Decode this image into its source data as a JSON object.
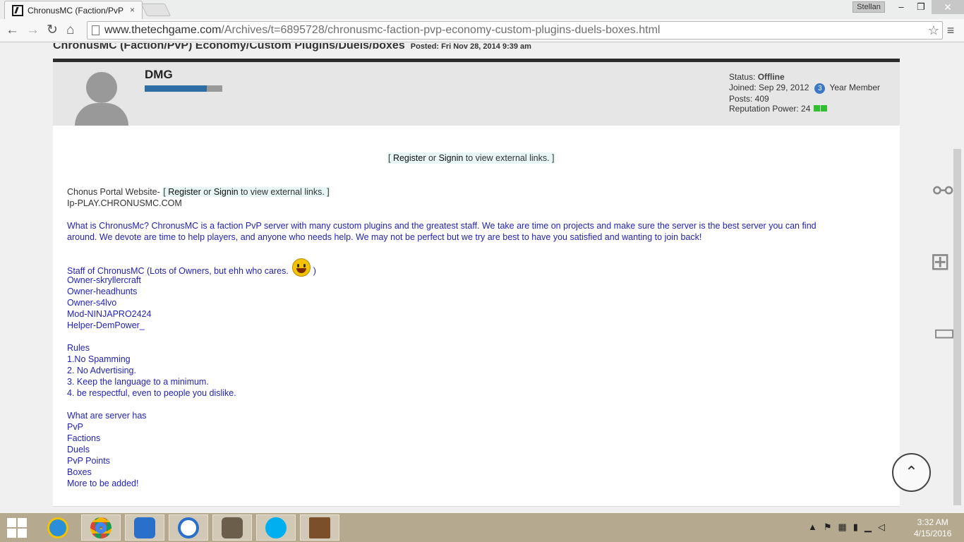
{
  "browser": {
    "tab_title": "ChronusMC (Faction/PvP",
    "tab_close": "×",
    "user": "Stellan",
    "url_domain": "www.thetechgame.com",
    "url_path": "/Archives/t=6895728/chronusmc-faction-pvp-economy-custom-plugins-duels-boxes.html"
  },
  "post": {
    "thread_title": "ChronusMC (Faction/PvP) Economy/Custom Plugins/Duels/boxes",
    "posted": "Posted: Fri Nov 28, 2014 9:39 am",
    "username": "DMG",
    "reputation_fill": 0.8,
    "status_label": "Status: ",
    "status_value": "Offline",
    "joined": "Joined: Sep 29, 2012",
    "years_badge": "3",
    "years_label": "Year Member",
    "posts": "Posts: 409",
    "rep_power": "Reputation Power: 24"
  },
  "ext_link": {
    "open": "[ ",
    "register": "Register",
    "or": " or ",
    "signin": "Signin",
    "rest": " to view external links. ]"
  },
  "content": {
    "portal_label": "Chonus Portal Website- ",
    "ip": "Ip-PLAY.CHRONUSMC.COM",
    "about_line1": "What is ChronusMc? ChronusMC is a faction PvP server with many custom plugins and the greatest staff. We take are time on projects and make sure the server is the best server you can find",
    "about_line2": "around. We devote are time to help players, and anyone who needs help. We may not be perfect but we try are best to have you satisfied and wanting to join back!",
    "staff_heading": "Staff of ChronusMC (Lots of Owners, but ehh who cares. ",
    "staff_close": " )",
    "staff": [
      "Owner-skryllercraft",
      "Owner-headhunts",
      "Owner-s4lvo",
      "Mod-NINJAPRO2424",
      "Helper-DemPower_"
    ],
    "rules_heading": "Rules",
    "rules": [
      "1.No Spamming",
      "2. No Advertising.",
      "3. Keep the language to a minimum.",
      "4. be respectful, even to people you dislike."
    ],
    "features_heading": "What are server has",
    "features": [
      "PvP",
      "Factions",
      "Duels",
      "PvP Points",
      "Boxes",
      "More to be added!"
    ]
  },
  "taskbar": {
    "time": "3:32 AM",
    "date": "4/15/2016"
  }
}
